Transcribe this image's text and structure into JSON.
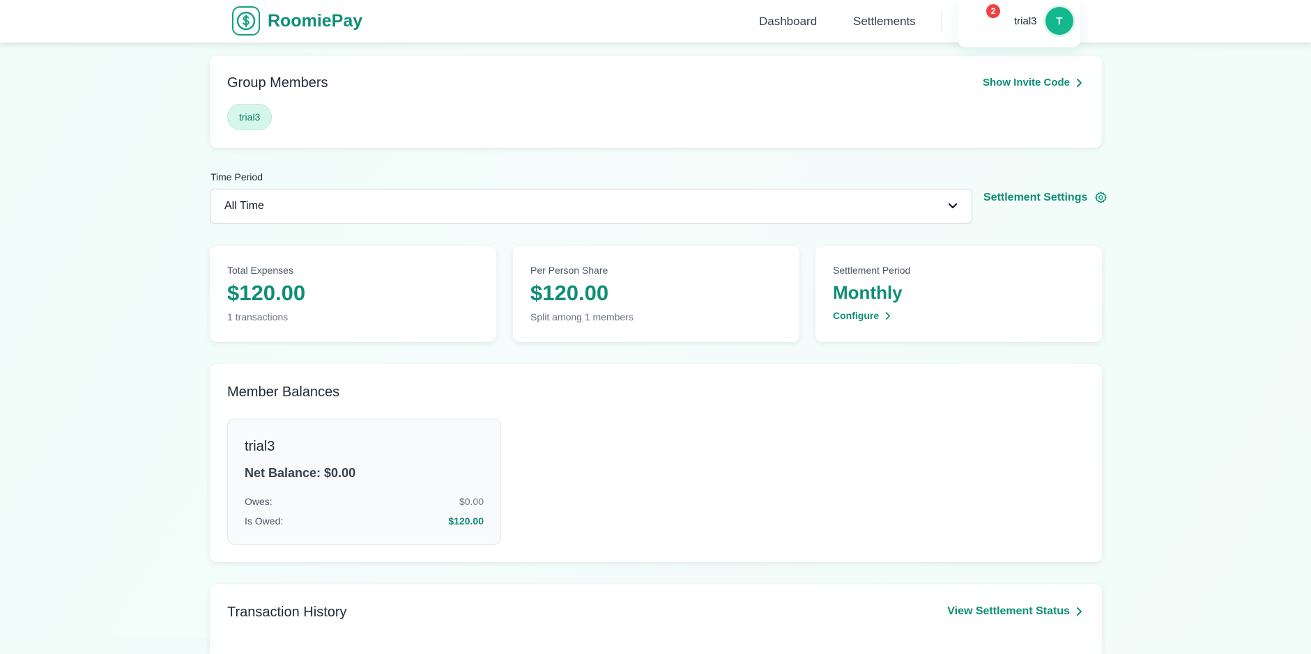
{
  "app": {
    "name": "RoomiePay"
  },
  "nav": {
    "items": [
      {
        "label": "Dashboard"
      },
      {
        "label": "Settlements"
      }
    ],
    "notification_count": "2",
    "user_name": "trial3",
    "avatar_initial": "T"
  },
  "group_members": {
    "title": "Group Members",
    "invite_link": "Show Invite Code",
    "members": [
      "trial3"
    ]
  },
  "filter": {
    "label": "Time Period",
    "selected": "All Time",
    "settings_link": "Settlement Settings"
  },
  "stats": {
    "total": {
      "label": "Total Expenses",
      "value": "$120.00",
      "sub": "1 transactions"
    },
    "per_person": {
      "label": "Per Person Share",
      "value": "$120.00",
      "sub": "Split among 1 members"
    },
    "period": {
      "label": "Settlement Period",
      "value": "Monthly",
      "link": "Configure"
    }
  },
  "balances": {
    "title": "Member Balances",
    "members": [
      {
        "name": "trial3",
        "net": "Net Balance: $0.00",
        "owes_label": "Owes:",
        "owes_value": "$0.00",
        "owed_label": "Is Owed:",
        "owed_value": "$120.00"
      }
    ]
  },
  "transactions": {
    "title": "Transaction History",
    "status_link": "View Settlement Status"
  },
  "colors": {
    "accent": "#0f8e76",
    "avatar": "#14b88f",
    "badge": "#ef4444",
    "chip_bg": "#d5f6eb"
  },
  "icons": [
    "dollar-logo-icon",
    "chevron-right-icon",
    "chevron-down-icon",
    "gear-icon"
  ]
}
